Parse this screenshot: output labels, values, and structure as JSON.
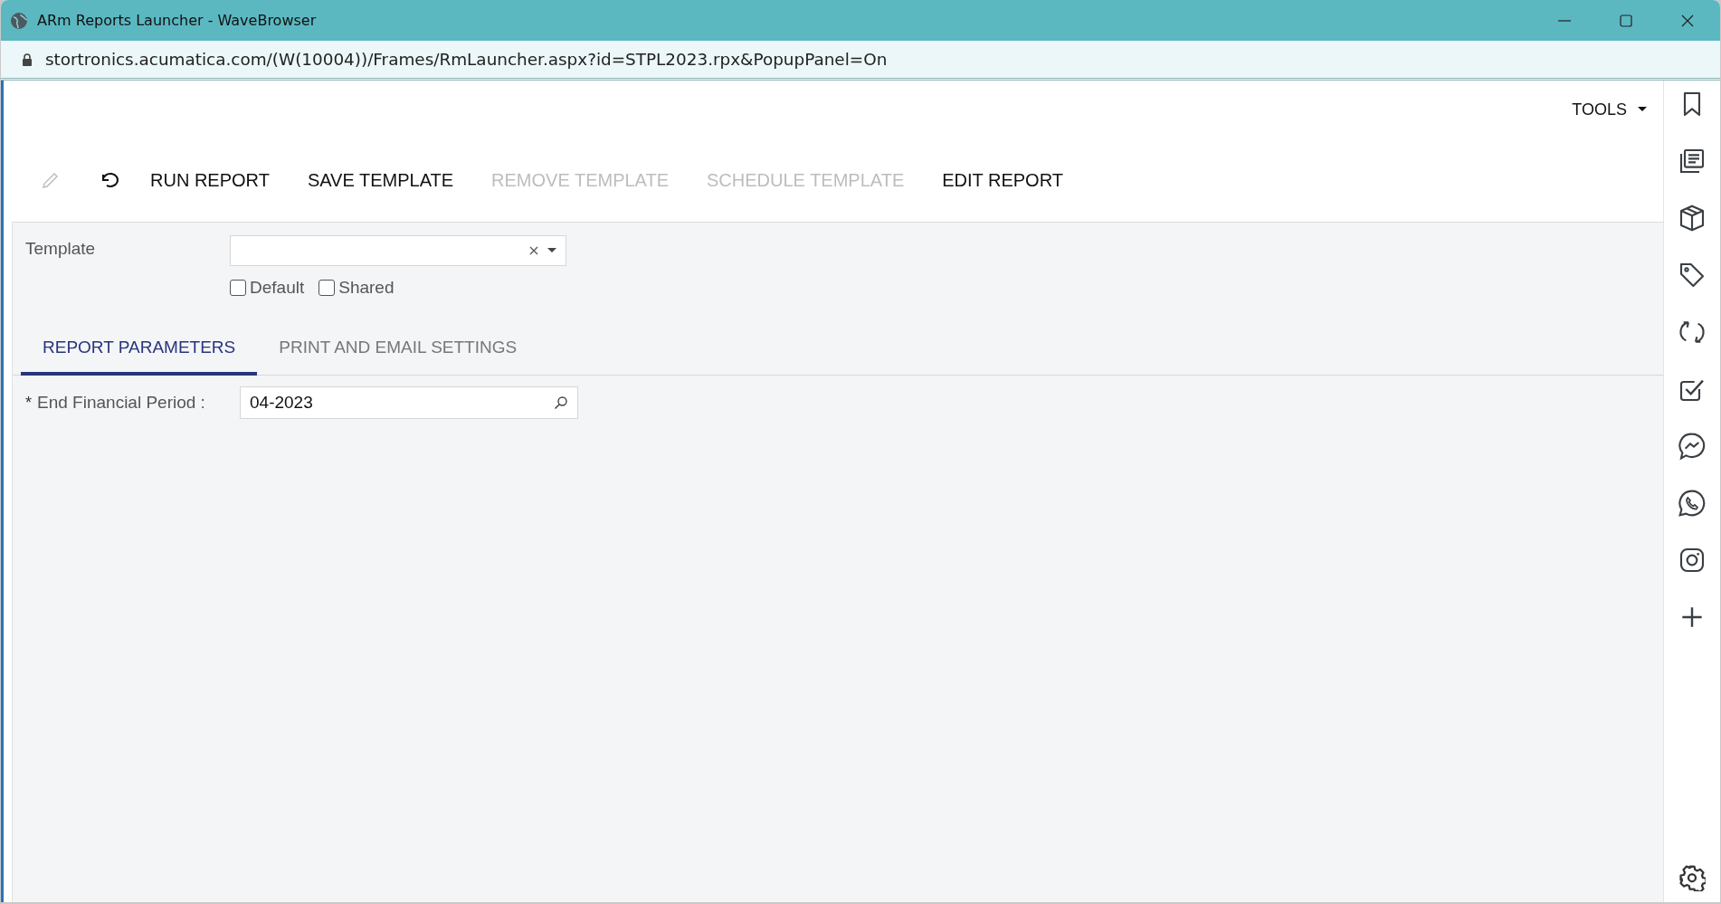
{
  "window": {
    "title": "ARm Reports Launcher - WaveBrowser"
  },
  "address_bar": {
    "url": "stortronics.acumatica.com/(W(10004))/Frames/RmLauncher.aspx?id=STPL2023.rpx&PopupPanel=On"
  },
  "tools_menu": {
    "label": "TOOLS"
  },
  "toolbar": {
    "icon_buttons": [
      {
        "disabled": true
      },
      {
        "disabled": false
      }
    ],
    "buttons": [
      {
        "label": "RUN REPORT",
        "disabled": false
      },
      {
        "label": "SAVE TEMPLATE",
        "disabled": false
      },
      {
        "label": "REMOVE TEMPLATE",
        "disabled": true
      },
      {
        "label": "SCHEDULE TEMPLATE",
        "disabled": true
      },
      {
        "label": "EDIT REPORT",
        "disabled": false
      }
    ]
  },
  "template": {
    "label": "Template",
    "options": [
      {
        "label": "Default",
        "checked": false
      },
      {
        "label": "Shared",
        "checked": false
      }
    ]
  },
  "tabs": [
    {
      "label": "REPORT PARAMETERS",
      "selected": true
    },
    {
      "label": "PRINT AND EMAIL SETTINGS",
      "selected": false
    }
  ],
  "parameters": [
    {
      "required_mark": "*",
      "label": "End Financial Period :",
      "value": "04-2023"
    }
  ]
}
